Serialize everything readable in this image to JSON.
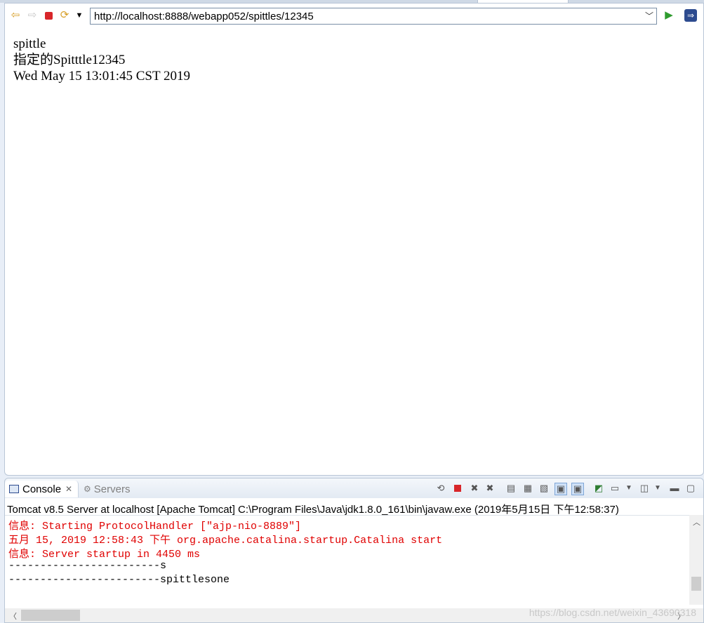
{
  "browser": {
    "url": "http://localhost:8888/webapp052/spittles/12345",
    "page_lines": [
      "spittle",
      "指定的Spitttle12345",
      "Wed May 15 13:01:45 CST 2019"
    ]
  },
  "console": {
    "tabs": [
      {
        "label": "Console",
        "active": true
      },
      {
        "label": "Servers",
        "active": false
      }
    ],
    "process_label": "Tomcat v8.5 Server at localhost [Apache Tomcat] C:\\Program Files\\Java\\jdk1.8.0_161\\bin\\javaw.exe (2019年5月15日 下午12:58:37)",
    "output_lines": [
      {
        "text": "信息: Starting ProtocolHandler [\"ajp-nio-8889\"]",
        "color": "#e00000"
      },
      {
        "text": "五月 15, 2019 12:58:43 下午 org.apache.catalina.startup.Catalina start",
        "color": "#e00000"
      },
      {
        "text": "信息: Server startup in 4450 ms",
        "color": "#e00000"
      },
      {
        "text": "------------------------s",
        "color": "#000000"
      },
      {
        "text": "------------------------spittlesone",
        "color": "#000000"
      }
    ]
  },
  "watermark": "https://blog.csdn.net/weixin_43690318",
  "icons": [
    "back-icon",
    "forward-icon",
    "stop-icon",
    "refresh-icon",
    "chevron-down-icon",
    "go-icon",
    "eclipse-icon",
    "console-icon",
    "servers-icon",
    "close-icon"
  ]
}
